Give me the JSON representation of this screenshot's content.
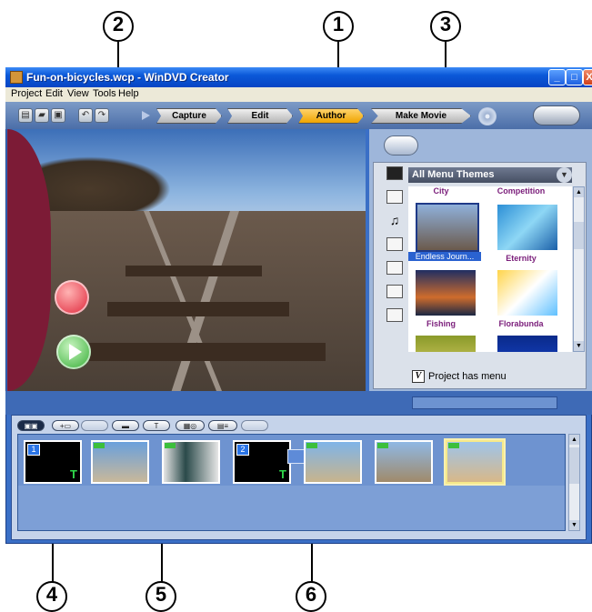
{
  "callouts": [
    "1",
    "2",
    "3",
    "4",
    "5",
    "6"
  ],
  "window": {
    "title": "Fun-on-bicycles.wcp - WinDVD Creator",
    "controls": {
      "minimize": "_",
      "maximize": "□",
      "close": "X"
    }
  },
  "menu": [
    "Project",
    "Edit",
    "View",
    "Tools",
    "Help"
  ],
  "toolbar": {
    "icons": [
      "new-icon",
      "open-icon",
      "save-icon",
      "undo-icon",
      "redo-icon"
    ],
    "steps": [
      {
        "label": "Capture",
        "active": false
      },
      {
        "label": "Edit",
        "active": false
      },
      {
        "label": "Author",
        "active": true
      },
      {
        "label": "Make Movie",
        "active": false
      }
    ]
  },
  "themes": {
    "dropdown": "All Menu Themes",
    "items": [
      {
        "label": "City",
        "cut": true
      },
      {
        "label": "Competition",
        "cut": true
      },
      {
        "label": "Endless Journ...",
        "selected": true
      },
      {
        "label": "Eternity"
      },
      {
        "label": "Fishing"
      },
      {
        "label": "Florabunda"
      }
    ],
    "project_has_menu_label": "Project has menu",
    "checkbox_mark": "V"
  },
  "timeline": {
    "buttons": [
      "edit-mode",
      "add",
      "remove",
      "title",
      "text",
      "search",
      "chapters",
      "marker"
    ],
    "clips": [
      {
        "num": "1",
        "title_mark": "T"
      },
      {
        "num": "",
        "title_mark": ""
      },
      {
        "num": "",
        "title_mark": ""
      },
      {
        "num": "2",
        "title_mark": "T"
      },
      {
        "num": "",
        "title_mark": ""
      },
      {
        "num": "",
        "title_mark": ""
      },
      {
        "num": "",
        "title_mark": ""
      }
    ]
  },
  "colors": {
    "xp_blue": "#0a58d8",
    "accent_orange": "#f0a400",
    "maroon": "#7c1b36",
    "theme_label": "#7a1d7a"
  }
}
